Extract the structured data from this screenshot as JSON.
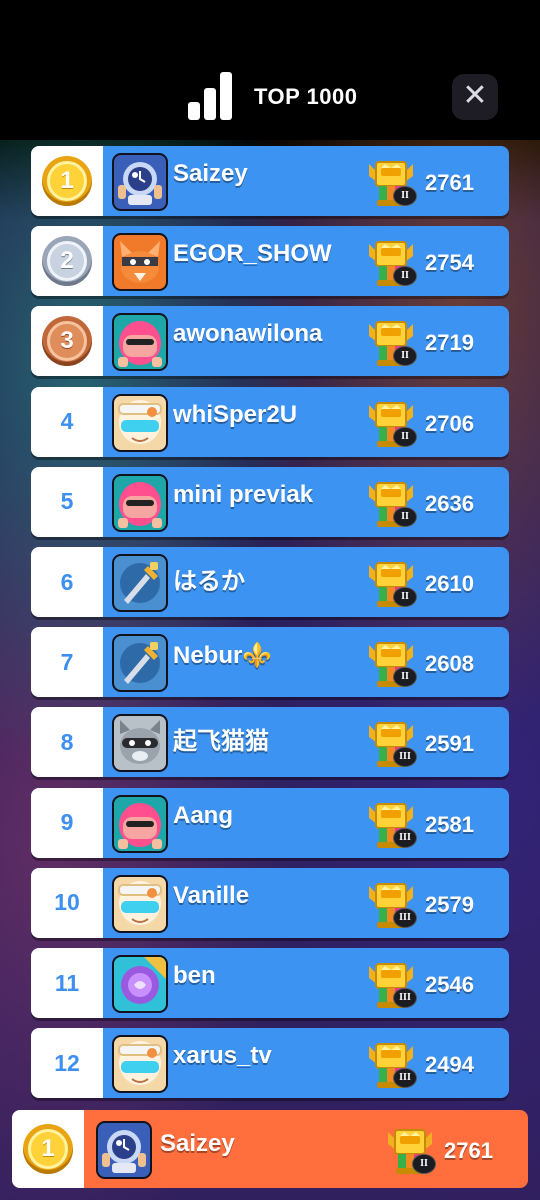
{
  "header": {
    "title": "TOP 1000",
    "close_symbol": "✕"
  },
  "colors": {
    "row_blue": "#3d93f2",
    "self_row_orange": "#ff6e3c",
    "rank_text": "#3d8ff0"
  },
  "leaderboard": [
    {
      "rank": "1",
      "name": "Saizey",
      "score": "2761",
      "league": "II",
      "medal": "gold",
      "avatar": "astronaut-clock"
    },
    {
      "rank": "2",
      "name": "EGOR_SHOW",
      "score": "2754",
      "league": "II",
      "medal": "silver",
      "avatar": "fox-ninja"
    },
    {
      "rank": "3",
      "name": "awonawilona",
      "score": "2719",
      "league": "II",
      "medal": "bronze",
      "avatar": "pink-hood"
    },
    {
      "rank": "4",
      "name": "whiSper2U",
      "score": "2706",
      "league": "II",
      "medal": "",
      "avatar": "visor-hero"
    },
    {
      "rank": "5",
      "name": "mini previak",
      "score": "2636",
      "league": "II",
      "medal": "",
      "avatar": "pink-hood"
    },
    {
      "rank": "6",
      "name": "はるか",
      "score": "2610",
      "league": "II",
      "medal": "",
      "avatar": "sword"
    },
    {
      "rank": "7",
      "name": "Nebur⚜️",
      "score": "2608",
      "league": "II",
      "medal": "",
      "avatar": "sword"
    },
    {
      "rank": "8",
      "name": "起飞猫猫",
      "score": "2591",
      "league": "III",
      "medal": "",
      "avatar": "raccoon"
    },
    {
      "rank": "9",
      "name": "Aang",
      "score": "2581",
      "league": "III",
      "medal": "",
      "avatar": "pink-hood"
    },
    {
      "rank": "10",
      "name": "Vanille",
      "score": "2579",
      "league": "III",
      "medal": "",
      "avatar": "visor-hero"
    },
    {
      "rank": "11",
      "name": "ben",
      "score": "2546",
      "league": "III",
      "medal": "",
      "avatar": "purple-orb"
    },
    {
      "rank": "12",
      "name": "xarus_tv",
      "score": "2494",
      "league": "III",
      "medal": "",
      "avatar": "visor-hero"
    }
  ],
  "me": {
    "rank": "1",
    "name": "Saizey",
    "score": "2761",
    "league": "II",
    "medal": "gold",
    "avatar": "astronaut-clock"
  }
}
